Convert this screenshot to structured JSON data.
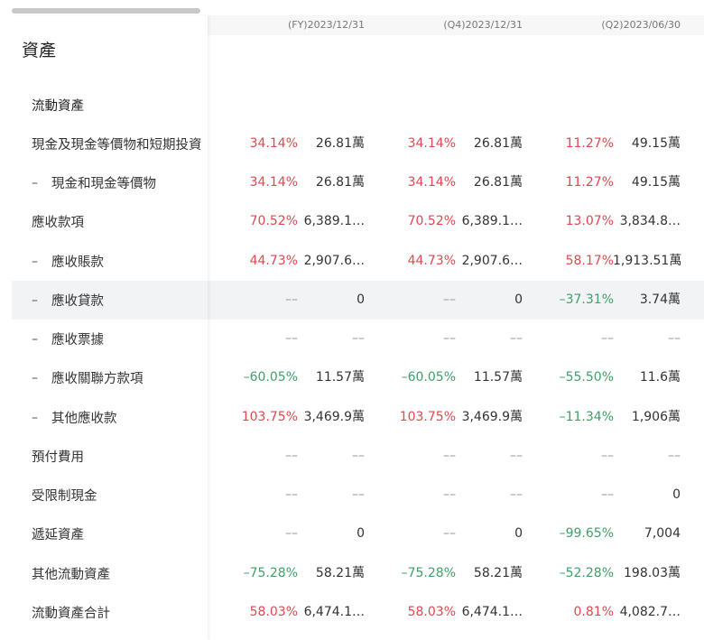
{
  "section_title": "資產",
  "periods": [
    "(FY)2023/12/31",
    "(Q4)2023/12/31",
    "(Q2)2023/06/30"
  ],
  "colors": {
    "positive": "#e0484f",
    "negative": "#3fa068",
    "highlight_row_bg": "#f2f3f5"
  },
  "rows": [
    {
      "label": "流動資產",
      "level": "group",
      "cells": []
    },
    {
      "label": "現金及現金等價物和短期投資",
      "level": 0,
      "cells": [
        {
          "pct": "34.14%",
          "val": "26.81萬"
        },
        {
          "pct": "34.14%",
          "val": "26.81萬"
        },
        {
          "pct": "11.27%",
          "val": "49.15萬"
        }
      ]
    },
    {
      "label": "現金和現金等價物",
      "level": 1,
      "cells": [
        {
          "pct": "34.14%",
          "val": "26.81萬"
        },
        {
          "pct": "34.14%",
          "val": "26.81萬"
        },
        {
          "pct": "11.27%",
          "val": "49.15萬"
        }
      ]
    },
    {
      "label": "應收款項",
      "level": 0,
      "cells": [
        {
          "pct": "70.52%",
          "val": "6,389.1…"
        },
        {
          "pct": "70.52%",
          "val": "6,389.1…"
        },
        {
          "pct": "13.07%",
          "val": "3,834.8…"
        }
      ]
    },
    {
      "label": "應收賬款",
      "level": 1,
      "cells": [
        {
          "pct": "44.73%",
          "val": "2,907.6…"
        },
        {
          "pct": "44.73%",
          "val": "2,907.6…"
        },
        {
          "pct": "58.17%",
          "val": "1,913.51萬"
        }
      ]
    },
    {
      "label": "應收貸款",
      "level": 1,
      "highlight": true,
      "cells": [
        {
          "pct": "––",
          "val": "0"
        },
        {
          "pct": "––",
          "val": "0"
        },
        {
          "pct": "–37.31%",
          "val": "3.74萬"
        }
      ]
    },
    {
      "label": "應收票據",
      "level": 1,
      "cells": [
        {
          "pct": "––",
          "val": "––"
        },
        {
          "pct": "––",
          "val": "––"
        },
        {
          "pct": "––",
          "val": "––"
        }
      ]
    },
    {
      "label": "應收關聯方款項",
      "level": 1,
      "cells": [
        {
          "pct": "–60.05%",
          "val": "11.57萬"
        },
        {
          "pct": "–60.05%",
          "val": "11.57萬"
        },
        {
          "pct": "–55.50%",
          "val": "11.6萬"
        }
      ]
    },
    {
      "label": "其他應收款",
      "level": 1,
      "cells": [
        {
          "pct": "103.75%",
          "val": "3,469.9萬"
        },
        {
          "pct": "103.75%",
          "val": "3,469.9萬"
        },
        {
          "pct": "–11.34%",
          "val": "1,906萬"
        }
      ]
    },
    {
      "label": "預付費用",
      "level": 0,
      "cells": [
        {
          "pct": "––",
          "val": "––"
        },
        {
          "pct": "––",
          "val": "––"
        },
        {
          "pct": "––",
          "val": "––"
        }
      ]
    },
    {
      "label": "受限制現金",
      "level": 0,
      "cells": [
        {
          "pct": "––",
          "val": "––"
        },
        {
          "pct": "––",
          "val": "––"
        },
        {
          "pct": "––",
          "val": "0"
        }
      ]
    },
    {
      "label": "遞延資產",
      "level": 0,
      "cells": [
        {
          "pct": "––",
          "val": "0"
        },
        {
          "pct": "––",
          "val": "0"
        },
        {
          "pct": "–99.65%",
          "val": "7,004"
        }
      ]
    },
    {
      "label": "其他流動資產",
      "level": 0,
      "cells": [
        {
          "pct": "–75.28%",
          "val": "58.21萬"
        },
        {
          "pct": "–75.28%",
          "val": "58.21萬"
        },
        {
          "pct": "–52.28%",
          "val": "198.03萬"
        }
      ]
    },
    {
      "label": "流動資產合計",
      "level": 0,
      "cells": [
        {
          "pct": "58.03%",
          "val": "6,474.1…"
        },
        {
          "pct": "58.03%",
          "val": "6,474.1…"
        },
        {
          "pct": "0.81%",
          "val": "4,082.7…"
        }
      ]
    }
  ]
}
